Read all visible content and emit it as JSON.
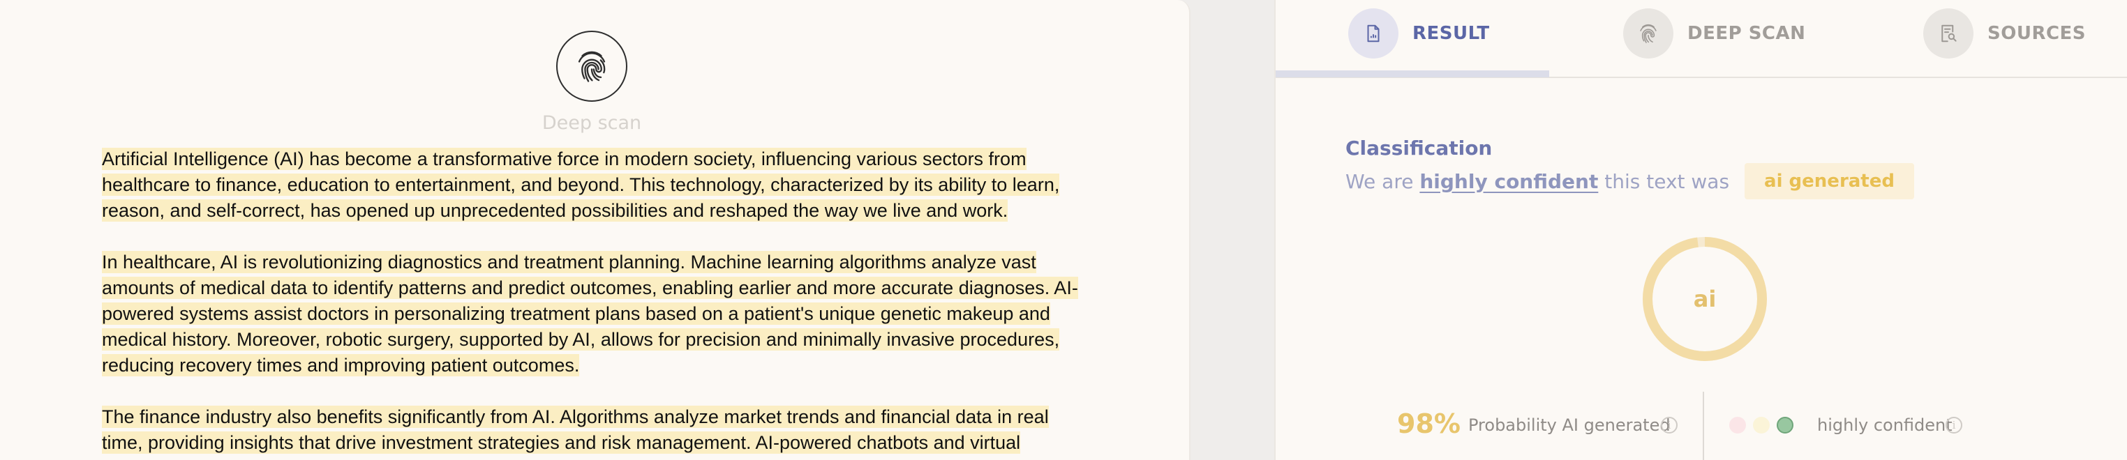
{
  "scan": {
    "label": "Deep scan",
    "icon": "fingerprint-icon"
  },
  "document": {
    "paragraphs": [
      "Artificial Intelligence (AI) has become a transformative force in modern society, influencing various sectors from healthcare to finance, education to entertainment, and beyond. This technology, characterized by its ability to learn, reason, and self-correct, has opened up unprecedented possibilities and reshaped the way we live and work.",
      "In healthcare, AI is revolutionizing diagnostics and treatment planning. Machine learning algorithms analyze vast amounts of medical data to identify patterns and predict outcomes, enabling earlier and more accurate diagnoses. AI-powered systems assist doctors in personalizing treatment plans based on a patient's unique genetic makeup and medical history. Moreover, robotic surgery, supported by AI, allows for precision and minimally invasive procedures, reducing recovery times and improving patient outcomes.",
      "The finance industry also benefits significantly from AI. Algorithms analyze market trends and financial data in real time, providing insights that drive investment strategies and risk management. AI-powered chatbots and virtual"
    ],
    "highlight_color": "#fbeec3"
  },
  "tabs": [
    {
      "label": "RESULT",
      "icon": "report-icon",
      "active": true
    },
    {
      "label": "DEEP SCAN",
      "icon": "fingerprint-icon",
      "active": false
    },
    {
      "label": "SOURCES",
      "icon": "document-search-icon",
      "active": false
    }
  ],
  "classification": {
    "title": "Classification",
    "prefix": "We are ",
    "confidence": "highly confident",
    "suffix": " this text was",
    "verdict": "ai generated"
  },
  "gauge": {
    "label": "ai",
    "value": 0.98,
    "color": "#f3dca6"
  },
  "stats": {
    "probability_value": "98%",
    "probability_label": "Probability AI generated",
    "confidence_label": "highly confident"
  },
  "colors": {
    "accent": "#5b66a6",
    "ai": "#e8c56c",
    "human": "#fbe5e7",
    "mixed": "#fbf4d8",
    "confidence_dot": "#98c7a0"
  }
}
